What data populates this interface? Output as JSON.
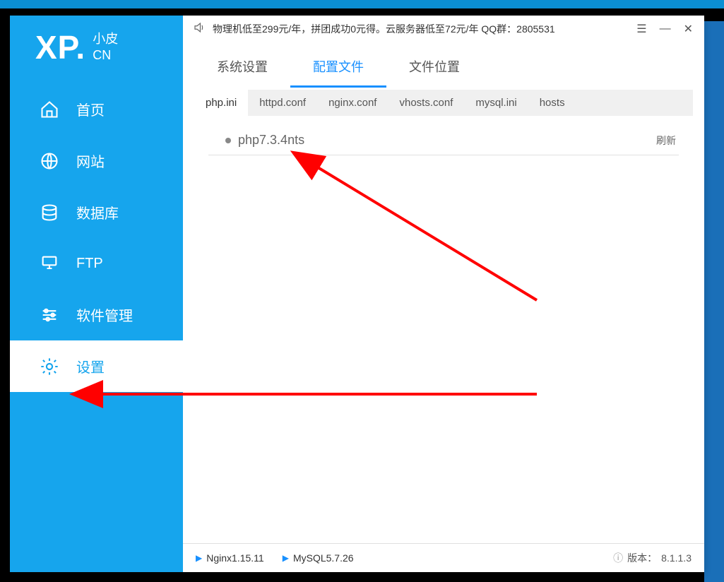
{
  "logo": {
    "xp": "XP.",
    "sub1": "小皮",
    "sub2": "CN"
  },
  "sidebar": {
    "items": [
      {
        "label": "首页"
      },
      {
        "label": "网站"
      },
      {
        "label": "数据库"
      },
      {
        "label": "FTP"
      },
      {
        "label": "软件管理"
      },
      {
        "label": "设置"
      }
    ]
  },
  "titlebar": {
    "notice": "物理机低至299元/年，拼团成功0元得。云服务器低至72元/年  QQ群：2805531"
  },
  "tabs_primary": [
    {
      "label": "系统设置"
    },
    {
      "label": "配置文件"
    },
    {
      "label": "文件位置"
    }
  ],
  "tabs_secondary": [
    {
      "label": "php.ini"
    },
    {
      "label": "httpd.conf"
    },
    {
      "label": "nginx.conf"
    },
    {
      "label": "vhosts.conf"
    },
    {
      "label": "mysql.ini"
    },
    {
      "label": "hosts"
    }
  ],
  "list": {
    "items": [
      {
        "label": "php7.3.4nts"
      }
    ],
    "refresh": "刷新"
  },
  "statusbar": {
    "nginx": "Nginx1.15.11",
    "mysql": "MySQL5.7.26",
    "version_label": "版本：",
    "version": "8.1.1.3"
  }
}
